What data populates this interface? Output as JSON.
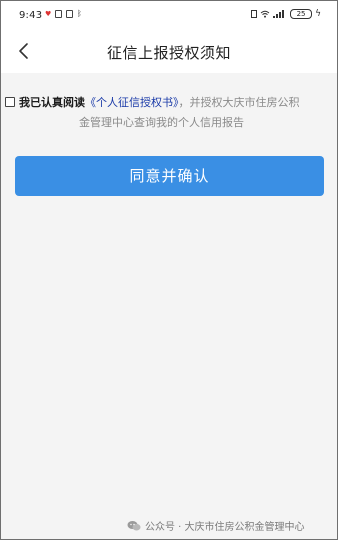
{
  "status_bar": {
    "time": "9:43",
    "battery": "25"
  },
  "header": {
    "title": "征信上报授权须知"
  },
  "consent": {
    "prefix": "我已认真阅读",
    "link": "《个人征信授权书》",
    "suffix": "，并授权大庆市住房公积",
    "line2": "金管理中心查询我的个人信用报告"
  },
  "agree_button": {
    "label": "同意并确认"
  },
  "watermark": {
    "text": "公众号 · 大庆市住房公积金管理中心"
  },
  "colors": {
    "accent": "#3a8fe4",
    "link": "#1a3aa8",
    "background": "#f4f4f4"
  },
  "icons": [
    "heart-icon",
    "bluetooth-icon",
    "vibrate-icon",
    "wifi-icon",
    "signal-icon",
    "battery-icon",
    "charging-icon",
    "back-arrow-icon",
    "wechat-icon"
  ]
}
